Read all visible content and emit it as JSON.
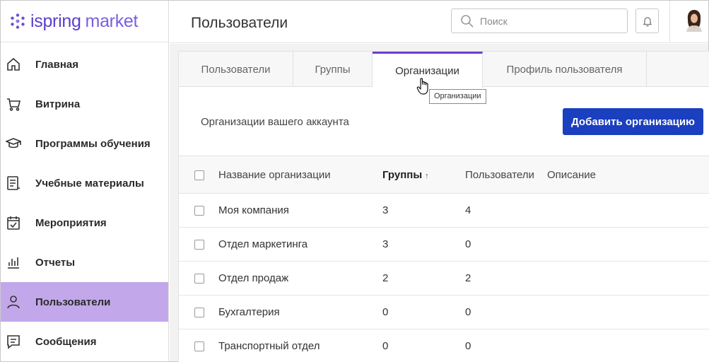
{
  "brand": {
    "name_part1": "ispring",
    "name_part2": "market",
    "accent": "#5b3fcf"
  },
  "sidebar": {
    "items": [
      {
        "label": "Главная",
        "icon": "home-icon"
      },
      {
        "label": "Витрина",
        "icon": "cart-icon"
      },
      {
        "label": "Программы обучения",
        "icon": "graduation-cap-icon"
      },
      {
        "label": "Учебные материалы",
        "icon": "document-icon"
      },
      {
        "label": "Мероприятия",
        "icon": "calendar-check-icon"
      },
      {
        "label": "Отчеты",
        "icon": "bar-chart-icon"
      },
      {
        "label": "Пользователи",
        "icon": "user-icon",
        "active": true
      },
      {
        "label": "Сообщения",
        "icon": "message-icon"
      }
    ],
    "active_color": "#c2a8ea"
  },
  "header": {
    "title": "Пользователи",
    "search_placeholder": "Поиск"
  },
  "tabs": [
    {
      "label": "Пользователи"
    },
    {
      "label": "Группы"
    },
    {
      "label": "Организации",
      "active": true
    },
    {
      "label": "Профиль пользователя"
    }
  ],
  "tooltip": "Организации",
  "main": {
    "subtitle": "Организации вашего аккаунта",
    "add_button": "Добавить организацию",
    "button_color": "#1a3fbf"
  },
  "table": {
    "columns": [
      "Название организации",
      "Группы",
      "Пользователи",
      "Описание"
    ],
    "sort_indicator": "↑",
    "rows": [
      {
        "name": "Моя компания",
        "groups": "3",
        "users": "4",
        "description": ""
      },
      {
        "name": "Отдел маркетинга",
        "groups": "3",
        "users": "0",
        "description": ""
      },
      {
        "name": "Отдел продаж",
        "groups": "2",
        "users": "2",
        "description": ""
      },
      {
        "name": "Бухгалтерия",
        "groups": "0",
        "users": "0",
        "description": ""
      },
      {
        "name": "Транспортный отдел",
        "groups": "0",
        "users": "0",
        "description": ""
      }
    ]
  }
}
